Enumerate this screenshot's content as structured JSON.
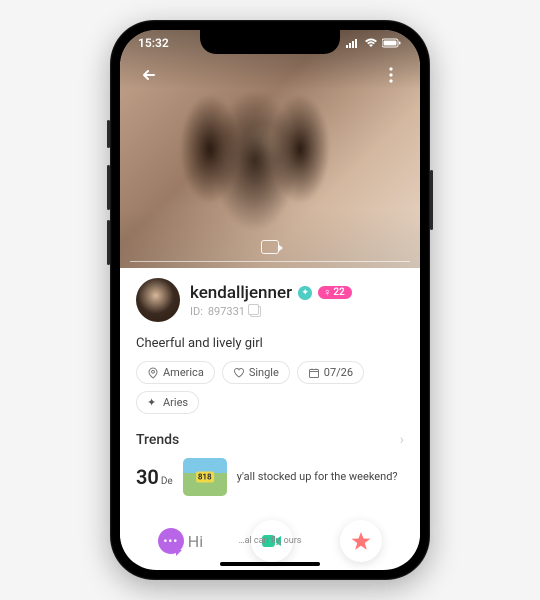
{
  "status": {
    "time": "15:32"
  },
  "profile": {
    "username": "kendalljenner",
    "age_badge": "22",
    "id_label": "ID:",
    "id_value": "897331",
    "bio": "Cheerful and lively girl"
  },
  "chips": {
    "location": "America",
    "relationship": "Single",
    "birthday": "07/26",
    "zodiac": "Aries"
  },
  "trends": {
    "title": "Trends",
    "day": "30",
    "month": "De",
    "text": "y'all stocked up for the weekend?"
  },
  "actions": {
    "hi_label": "Hi"
  },
  "overflow": "…al can fly, ours"
}
